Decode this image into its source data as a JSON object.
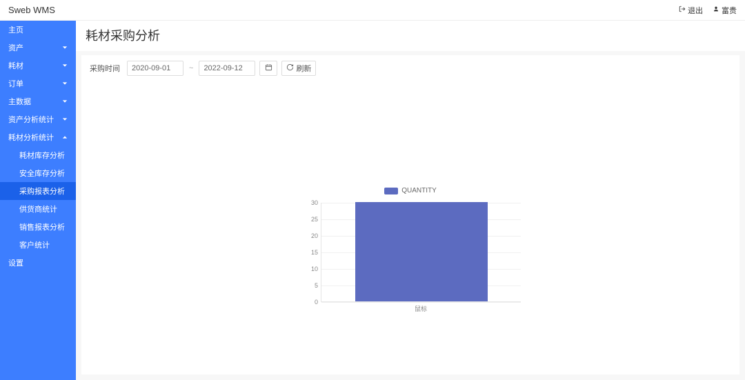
{
  "header": {
    "brand": "Sweb WMS",
    "logout": "退出",
    "user": "富贵"
  },
  "sidebar": {
    "items": [
      {
        "label": "主页",
        "expandable": false
      },
      {
        "label": "资产",
        "expandable": true,
        "open": false
      },
      {
        "label": "耗材",
        "expandable": true,
        "open": false
      },
      {
        "label": "订单",
        "expandable": true,
        "open": false
      },
      {
        "label": "主数据",
        "expandable": true,
        "open": false
      },
      {
        "label": "资产分析统计",
        "expandable": true,
        "open": false
      },
      {
        "label": "耗材分析统计",
        "expandable": true,
        "open": true,
        "children": [
          {
            "label": "耗材库存分析",
            "active": false
          },
          {
            "label": "安全库存分析",
            "active": false
          },
          {
            "label": "采购报表分析",
            "active": true
          },
          {
            "label": "供货商统计",
            "active": false
          },
          {
            "label": "销售报表分析",
            "active": false
          },
          {
            "label": "客户统计",
            "active": false
          }
        ]
      },
      {
        "label": "设置",
        "expandable": false
      }
    ]
  },
  "page": {
    "title": "耗材采购分析",
    "filter": {
      "label": "采购时间",
      "start": "2020-09-01",
      "sep": "~",
      "end": "2022-09-12",
      "refresh": "刷新"
    }
  },
  "chart_data": {
    "type": "bar",
    "legend": "QUANTITY",
    "categories": [
      "鼠标"
    ],
    "values": [
      30
    ],
    "ylim": [
      0,
      30
    ],
    "yticks": [
      0,
      5,
      10,
      15,
      20,
      25,
      30
    ],
    "bar_color": "#5c6bc0"
  }
}
